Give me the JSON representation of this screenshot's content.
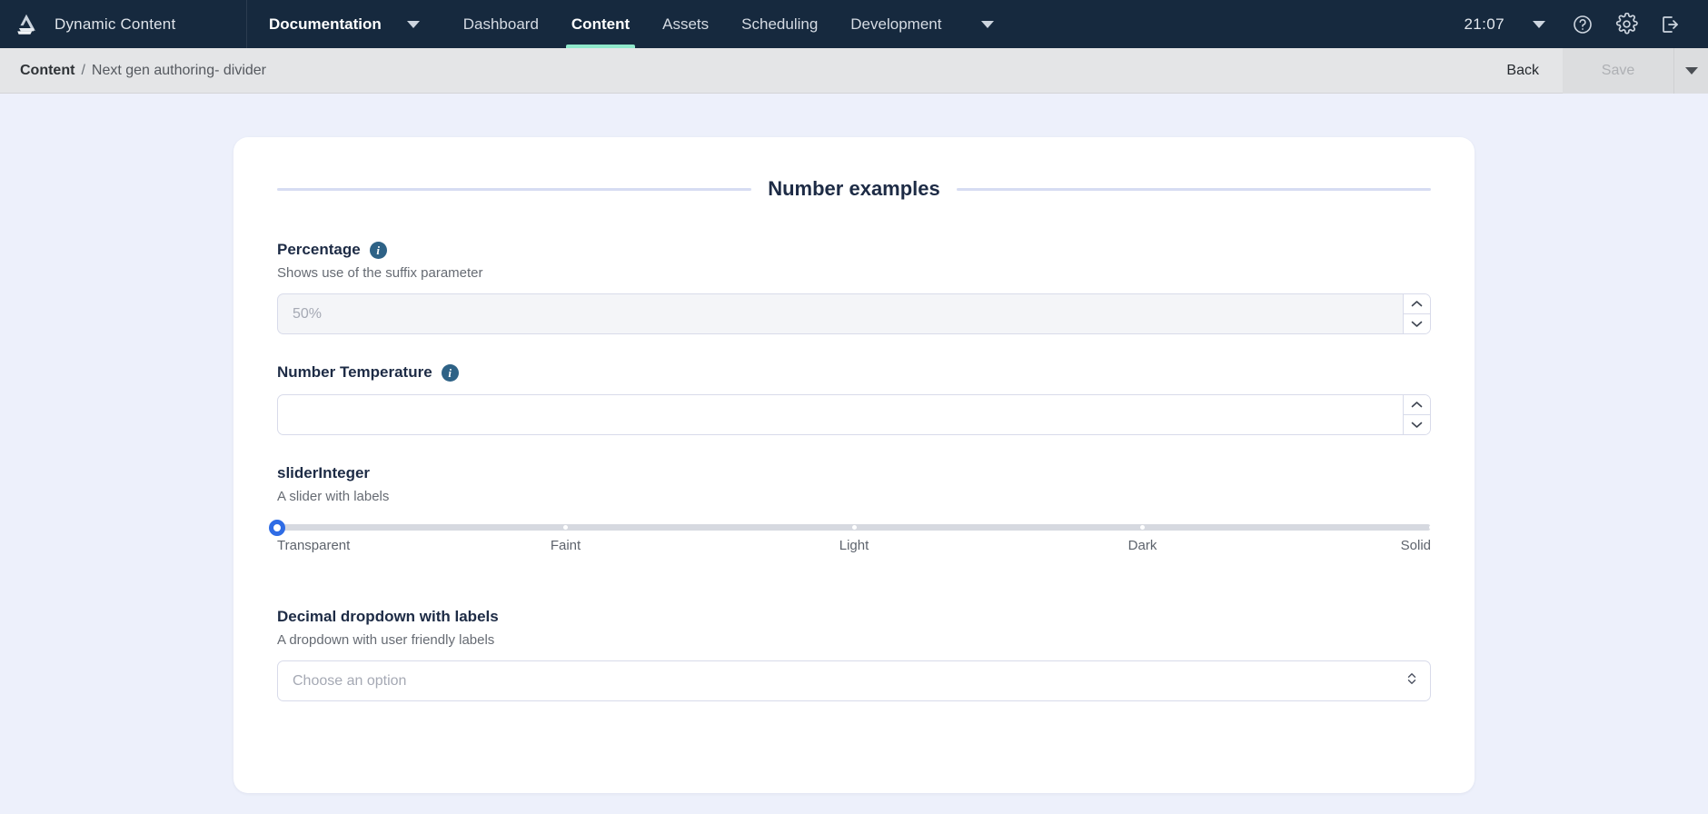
{
  "topnav": {
    "logo_icon": "amplience-logo-icon",
    "brand": "Dynamic Content",
    "primary": {
      "label": "Documentation",
      "caret_icon": "chevron-down-icon"
    },
    "tabs": [
      {
        "label": "Dashboard",
        "active": false
      },
      {
        "label": "Content",
        "active": true
      },
      {
        "label": "Assets",
        "active": false
      },
      {
        "label": "Scheduling",
        "active": false
      },
      {
        "label": "Development",
        "active": false
      }
    ],
    "tabs_caret_icon": "chevron-down-icon",
    "clock": "21:07",
    "clock_caret_icon": "chevron-down-icon",
    "help_icon": "help-circle-icon",
    "settings_icon": "gear-icon",
    "logout_icon": "logout-icon",
    "colors": {
      "bg": "#16293e",
      "active_underline": "#8fe8cb"
    }
  },
  "breadcrumb": {
    "root": "Content",
    "separator": "/",
    "leaf": "Next gen authoring- divider",
    "back_label": "Back",
    "save_label": "Save",
    "save_caret_icon": "chevron-down-icon",
    "save_disabled": true
  },
  "card": {
    "section_title": "Number examples",
    "divider_color": "#d6dcf2",
    "fields": [
      {
        "name": "percentage",
        "label": "Percentage",
        "info_icon": "info-icon",
        "info_glyph": "i",
        "description": "Shows use of the suffix parameter",
        "type": "number",
        "value": "",
        "placeholder": "50%",
        "stepper_up_icon": "chevron-up-icon",
        "stepper_down_icon": "chevron-down-icon"
      },
      {
        "name": "number-temperature",
        "label": "Number Temperature",
        "info_icon": "info-icon",
        "info_glyph": "i",
        "description": "",
        "type": "number",
        "value": "",
        "placeholder": "",
        "stepper_up_icon": "chevron-up-icon",
        "stepper_down_icon": "chevron-down-icon"
      },
      {
        "name": "slider-integer",
        "label": "sliderInteger",
        "description": "A slider with labels",
        "type": "slider",
        "value": 0,
        "min": 0,
        "max": 4,
        "ticks": [
          {
            "label": "Transparent",
            "position": 0
          },
          {
            "label": "Faint",
            "position": 25
          },
          {
            "label": "Light",
            "position": 50
          },
          {
            "label": "Dark",
            "position": 75
          },
          {
            "label": "Solid",
            "position": 100
          }
        ],
        "accent_color": "#2f6ce5",
        "track_color": "#d6d9e0"
      },
      {
        "name": "decimal-dropdown",
        "label": "Decimal dropdown with labels",
        "description": "A dropdown with user friendly labels",
        "type": "select",
        "value": "",
        "placeholder": "Choose an option",
        "chevron_icon": "chevron-up-down-icon"
      }
    ]
  }
}
